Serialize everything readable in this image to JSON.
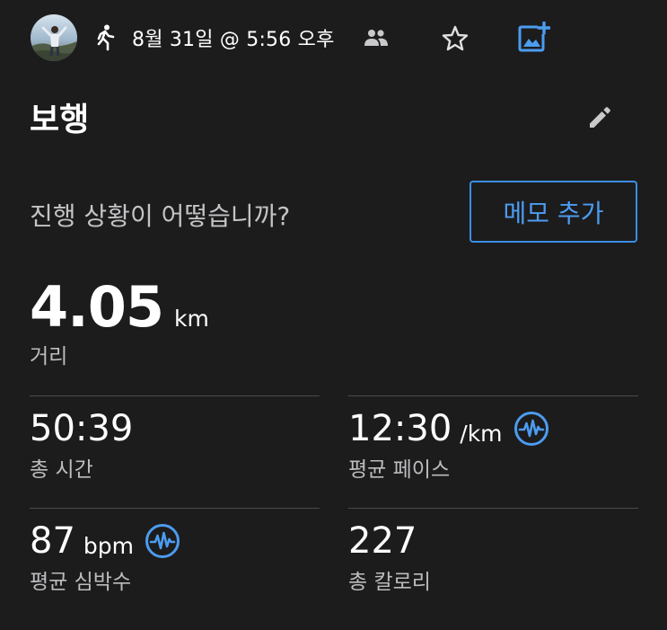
{
  "header": {
    "date": "8월 31일 @ 5:56 오후"
  },
  "activity": {
    "title": "보행",
    "prompt": "진행 상황이 어떻습니까?",
    "memo_button": "메모 추가"
  },
  "distance": {
    "value": "4.05",
    "unit": "km",
    "label": "거리"
  },
  "stats": {
    "total_time": {
      "value": "50:39",
      "label": "총 시간"
    },
    "avg_pace": {
      "value": "12:30",
      "unit": "/km",
      "label": "평균 페이스"
    },
    "avg_hr": {
      "value": "87",
      "unit": "bpm",
      "label": "평균 심박수"
    },
    "calories": {
      "value": "227",
      "label": "총 칼로리"
    }
  },
  "colors": {
    "background": "#1c1c1d",
    "accent": "#4c9cf0",
    "divider": "#4a4a4c",
    "secondary_text": "#bdbdbf"
  },
  "icons": [
    "walking-icon",
    "people-icon",
    "star-icon",
    "add-photo-icon",
    "edit-pencil-icon",
    "heart-rate-icon"
  ]
}
